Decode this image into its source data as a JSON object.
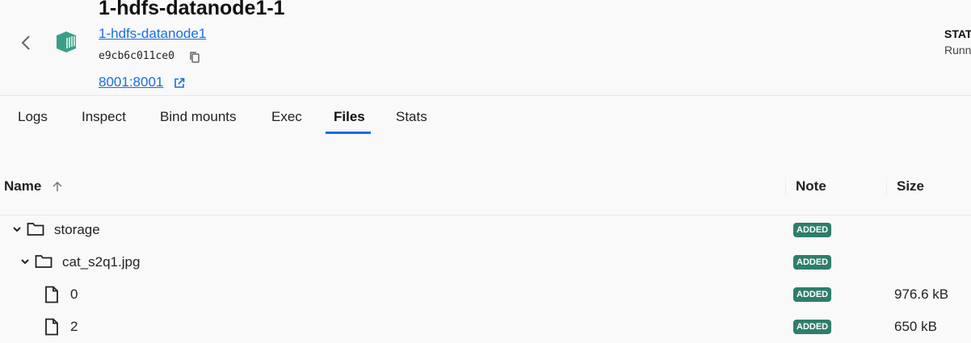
{
  "header": {
    "title": "1-hdfs-datanode1-1",
    "image_link": "1-hdfs-datanode1",
    "container_id": "e9cb6c011ce0",
    "port_link": "8001:8001",
    "status_label": "STATUS",
    "status_value": "Running"
  },
  "tabs": [
    {
      "label": "Logs"
    },
    {
      "label": "Inspect"
    },
    {
      "label": "Bind mounts"
    },
    {
      "label": "Exec"
    },
    {
      "label": "Files",
      "active": true
    },
    {
      "label": "Stats"
    }
  ],
  "table": {
    "columns": {
      "name": "Name",
      "note": "Note",
      "size": "Size"
    },
    "rows": [
      {
        "name": "storage",
        "type": "folder",
        "note": "ADDED",
        "size": ""
      },
      {
        "name": "cat_s2q1.jpg",
        "type": "folder",
        "note": "ADDED",
        "size": ""
      },
      {
        "name": "0",
        "type": "file",
        "note": "ADDED",
        "size": "976.6 kB"
      },
      {
        "name": "2",
        "type": "file",
        "note": "ADDED",
        "size": "650 kB"
      }
    ]
  },
  "colors": {
    "accent": "#1a6de0",
    "badge": "#2e7d6e",
    "container_icon": "#3a9f89"
  }
}
